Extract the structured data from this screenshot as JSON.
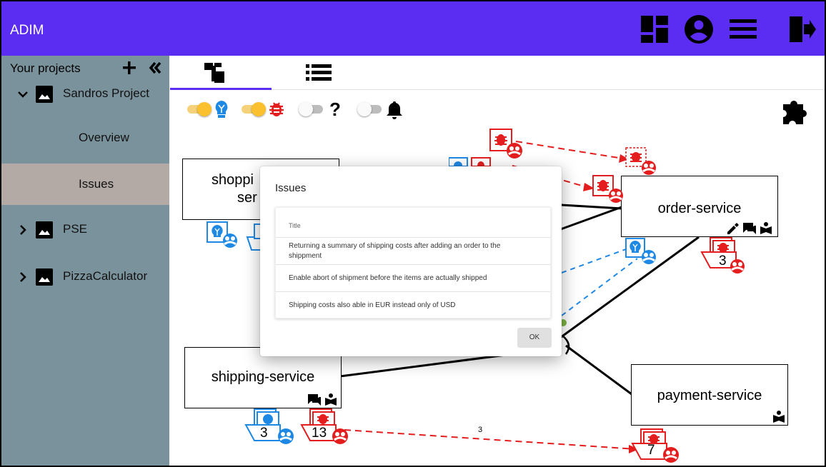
{
  "app": {
    "title": "ADIM"
  },
  "topbar": {
    "icons": [
      "dashboard-icon",
      "account-circle-icon",
      "menu-icon",
      "logout-icon"
    ]
  },
  "sidebar": {
    "header": "Your projects",
    "projects": [
      {
        "label": "Sandros Project",
        "expanded": true,
        "children": [
          "Overview",
          "Issues"
        ]
      },
      {
        "label": "PSE",
        "expanded": false
      },
      {
        "label": "PizzaCalculator",
        "expanded": false
      }
    ]
  },
  "tabs": [
    {
      "icon": "hierarchy-icon"
    },
    {
      "icon": "list-icon"
    }
  ],
  "toggles": [
    {
      "icon": "lightbulb-icon",
      "on": true
    },
    {
      "icon": "bug-icon",
      "on": true
    },
    {
      "icon": "question-icon",
      "on": false
    },
    {
      "icon": "bell-icon",
      "on": false
    }
  ],
  "diagram": {
    "services": {
      "shopping": {
        "name_line1": "shoppi",
        "name_line2": "ser"
      },
      "order": {
        "name": "order-service"
      },
      "shipping": {
        "name": "shipping-service"
      },
      "payment": {
        "name": "payment-service"
      }
    },
    "badges": {
      "order_bugs": "3",
      "shipping_features": "3",
      "shipping_bugs": "13",
      "payment_bugs": "7"
    },
    "edge_label": "3"
  },
  "dialog": {
    "title": "Issues",
    "column_header": "Title",
    "rows": [
      "Returning a summary of shipping costs after adding an order to the shippment",
      "Enable abort of shipment before the items are actually shipped",
      "Shipping costs also able in EUR instead only of USD"
    ],
    "ok_label": "OK"
  },
  "colors": {
    "primary": "#5b2df2",
    "sidebar": "#7a929c",
    "sidebar_active": "#b3aaa6",
    "bug_red": "#e41e1e",
    "feature_blue": "#1e88e5",
    "toggle_on": "#fbc02d"
  }
}
